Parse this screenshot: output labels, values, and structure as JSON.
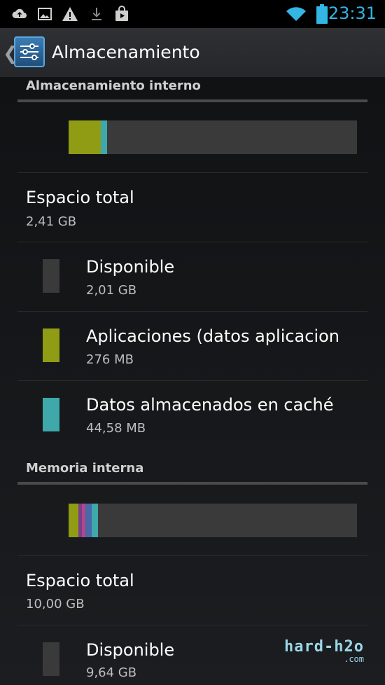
{
  "status_bar": {
    "icons": [
      "cloud-upload-icon",
      "image-icon",
      "warning-icon",
      "download-icon",
      "shopping-bag-icon",
      "wifi-icon",
      "battery-icon"
    ],
    "time": "23:31"
  },
  "action_bar": {
    "title": "Almacenamiento",
    "icon": "settings-sliders-icon"
  },
  "colors": {
    "available": "#3a3a3a",
    "apps": "#8f9c14",
    "cache": "#3ea8aa",
    "accent": "#33b5e5"
  },
  "internal_storage": {
    "header": "Almacenamiento interno",
    "usage_fractions": {
      "apps": 0.112,
      "cache": 0.022,
      "available": 0.866
    },
    "total": {
      "label": "Espacio total",
      "value": "2,41 GB"
    },
    "items": [
      {
        "label": "Disponible",
        "value": "2,01 GB"
      },
      {
        "label": "Aplicaciones (datos aplicacion",
        "value": "276 MB"
      },
      {
        "label": "Datos almacenados en caché",
        "value": "44,58 MB"
      }
    ]
  },
  "internal_memory": {
    "header": "Memoria interna",
    "usage_segments": [
      {
        "color": "#8f9c14",
        "fraction": 0.035
      },
      {
        "color": "#7a3e8a",
        "fraction": 0.012
      },
      {
        "color": "#b0468c",
        "fraction": 0.012
      },
      {
        "color": "#4868a8",
        "fraction": 0.022
      },
      {
        "color": "#3ea8aa",
        "fraction": 0.022
      }
    ],
    "total": {
      "label": "Espacio total",
      "value": "10,00 GB"
    },
    "items": [
      {
        "label": "Disponible",
        "value": "9,64 GB"
      }
    ]
  },
  "watermark": {
    "main": "hard-h2o",
    "sub": ".com"
  }
}
